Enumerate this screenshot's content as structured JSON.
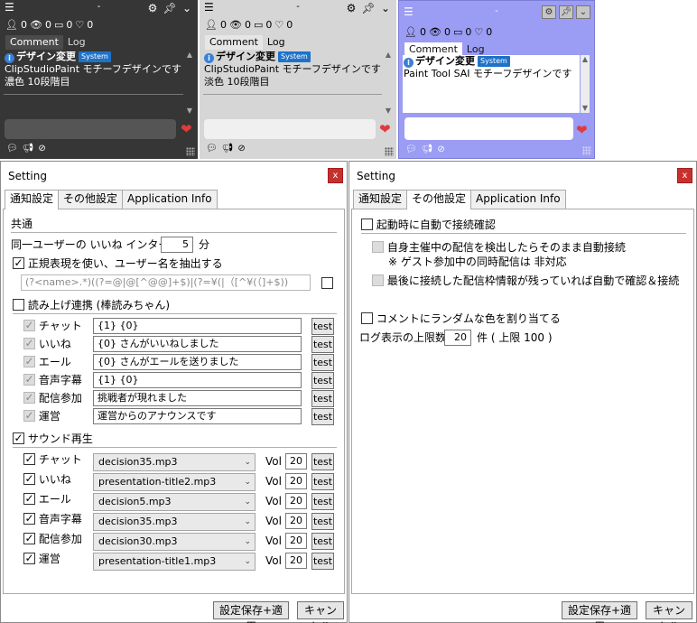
{
  "widgets": [
    {
      "menu_icon": "hamburger-icon",
      "title": "-",
      "stats": [
        "0",
        "0",
        "0",
        "0"
      ],
      "tabs": [
        "Comment",
        "Log"
      ],
      "comment_header": "デザイン変更",
      "badge": "System",
      "lines": [
        "ClipStudioPaint モチーフデザインです",
        "濃色 10段階目"
      ]
    },
    {
      "menu_icon": "hamburger-icon",
      "title": "-",
      "stats": [
        "0",
        "0",
        "0",
        "0"
      ],
      "tabs": [
        "Comment",
        "Log"
      ],
      "comment_header": "デザイン変更",
      "badge": "System",
      "lines": [
        "ClipStudioPaint モチーフデザインです",
        "淡色 10段階目"
      ]
    },
    {
      "menu_icon": "hamburger-icon",
      "title": "-",
      "stats": [
        "0",
        "0",
        "0",
        "0"
      ],
      "tabs": [
        "Comment",
        "Log"
      ],
      "comment_header": "デザイン変更",
      "badge": "System",
      "lines": [
        "Paint Tool SAI モチーフデザインです"
      ]
    }
  ],
  "dialog1": {
    "title": "Setting",
    "close": "x",
    "tabs": [
      "通知設定",
      "その他設定",
      "Application Info"
    ],
    "section_common": "共通",
    "interval_label": "同一ユーザーの いいね インターバル",
    "interval_value": "5",
    "interval_unit": "分",
    "regex_label": "正規表現を使い、ユーザー名を抽出する",
    "regex_value": "(?<name>.*)((?=@|@[^@@]+$)|(?=¥(|（[^¥(（]+$))",
    "bouyomi_label": "読み上げ連携 (棒読みちゃん)",
    "bouyomi_rows": [
      {
        "label": "チャット",
        "value": "{1} {0}",
        "test": "test"
      },
      {
        "label": "いいね",
        "value": "{0} さんがいいねしました",
        "test": "test"
      },
      {
        "label": "エール",
        "value": "{0} さんがエールを送りました",
        "test": "test"
      },
      {
        "label": "音声字幕",
        "value": "{1} {0}",
        "test": "test"
      },
      {
        "label": "配信参加",
        "value": "挑戦者が現れました",
        "test": "test"
      },
      {
        "label": "運営",
        "value": "運営からのアナウンスです",
        "test": "test"
      }
    ],
    "sound_label": "サウンド再生",
    "sound_rows": [
      {
        "label": "チャット",
        "file": "decision35.mp3",
        "vol_label": "Vol",
        "vol": "20",
        "test": "test"
      },
      {
        "label": "いいね",
        "file": "presentation-title2.mp3",
        "vol_label": "Vol",
        "vol": "20",
        "test": "test"
      },
      {
        "label": "エール",
        "file": "decision5.mp3",
        "vol_label": "Vol",
        "vol": "20",
        "test": "test"
      },
      {
        "label": "音声字幕",
        "file": "decision35.mp3",
        "vol_label": "Vol",
        "vol": "20",
        "test": "test"
      },
      {
        "label": "配信参加",
        "file": "decision30.mp3",
        "vol_label": "Vol",
        "vol": "20",
        "test": "test"
      },
      {
        "label": "運営",
        "file": "presentation-title1.mp3",
        "vol_label": "Vol",
        "vol": "20",
        "test": "test"
      }
    ],
    "save_button": "設定保存+適用",
    "cancel_button": "キャンセル"
  },
  "dialog2": {
    "title": "Setting",
    "close": "x",
    "tabs": [
      "通知設定",
      "その他設定",
      "Application Info"
    ],
    "auto_connect_label": "起動時に自動で接続確認",
    "self_host_label": "自身主催中の配信を検出したらそのまま自動接続",
    "guest_note": "※ ゲスト参加中の同時配信は 非対応",
    "last_conn_label": "最後に接続した配信枠情報が残っていれば自動で確認＆接続",
    "random_color_label": "コメントにランダムな色を割り当てる",
    "log_limit_label": "ログ表示の上限数",
    "log_limit_value": "20",
    "log_limit_unit": "件 ( 上限 100 )",
    "save_button": "設定保存+適用",
    "cancel_button": "キャンセル"
  }
}
